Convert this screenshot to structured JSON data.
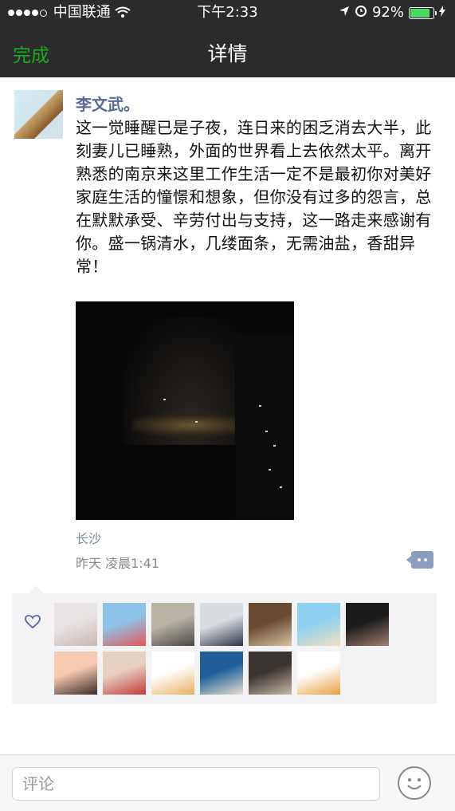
{
  "status_bar": {
    "carrier": "中国联通",
    "time": "下午2:33",
    "battery": "92%",
    "battery_level": 0.92
  },
  "nav": {
    "done_label": "完成",
    "title": "详情"
  },
  "post": {
    "author": "李文武。",
    "text": "这一觉睡醒已是子夜，连日来的困乏消去大半，此刻妻儿已睡熟，外面的世界看上去依然太平。离开熟悉的南京来这里工作生活一定不是最初你对美好家庭生活的憧憬和想象，但你没有过多的怨言，总在默默承受、辛劳付出与支持，这一路走来感谢有你。盛一锅清水，几缕面条，无需油盐，香甜异常！",
    "location": "长沙",
    "time": "昨天 凌晨1:41"
  },
  "likes": {
    "avatars": [
      {
        "name": "like-avatar-1",
        "colors": [
          "#e8e4e4",
          "#c9b7b0"
        ]
      },
      {
        "name": "like-avatar-2",
        "colors": [
          "#8fc2e8",
          "#e35a5a"
        ]
      },
      {
        "name": "like-avatar-3",
        "colors": [
          "#b9b3a6",
          "#4a4743"
        ]
      },
      {
        "name": "like-avatar-4",
        "colors": [
          "#d9dde2",
          "#2d3445"
        ]
      },
      {
        "name": "like-avatar-5",
        "colors": [
          "#6b4a33",
          "#d8c2a0"
        ]
      },
      {
        "name": "like-avatar-6",
        "colors": [
          "#8fd0f0",
          "#f2e0c0"
        ]
      },
      {
        "name": "like-avatar-7",
        "colors": [
          "#1b1b1b",
          "#a08070"
        ]
      },
      {
        "name": "like-avatar-8",
        "colors": [
          "#f6c9b0",
          "#3a2a28"
        ]
      },
      {
        "name": "like-avatar-9",
        "colors": [
          "#e8d0c0",
          "#c23a3a"
        ]
      },
      {
        "name": "like-avatar-10",
        "colors": [
          "#ffffff",
          "#e8b060"
        ]
      },
      {
        "name": "like-avatar-11",
        "colors": [
          "#1e5f9a",
          "#e8e0d0"
        ]
      },
      {
        "name": "like-avatar-12",
        "colors": [
          "#3a3430",
          "#c8b8a8"
        ]
      },
      {
        "name": "like-avatar-13",
        "colors": [
          "#ffffff",
          "#e8a040"
        ]
      }
    ]
  },
  "comment_bar": {
    "placeholder": "评论"
  }
}
